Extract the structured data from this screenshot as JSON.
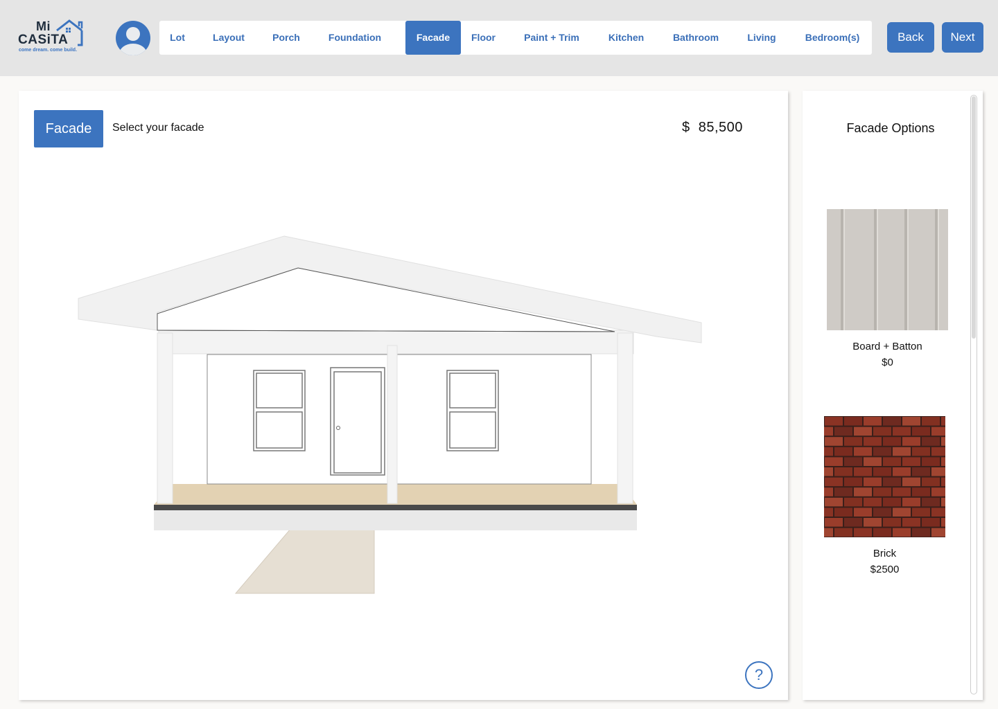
{
  "brand": {
    "line1": "Mi",
    "line2": "CASiTA",
    "tagline": "come dream. come build.",
    "color": "#3c74bf"
  },
  "user": {
    "avatar_icon": "user-avatar-icon"
  },
  "nav": {
    "tabs": [
      {
        "label": "Lot",
        "active": false
      },
      {
        "label": "Layout",
        "active": false
      },
      {
        "label": "Porch",
        "active": false
      },
      {
        "label": "Foundation",
        "active": false
      },
      {
        "label": "Facade",
        "active": true
      },
      {
        "label": "Floor",
        "active": false
      },
      {
        "label": "Paint + Trim",
        "active": false
      },
      {
        "label": "Kitchen",
        "active": false
      },
      {
        "label": "Bathroom",
        "active": false
      },
      {
        "label": "Living",
        "active": false
      },
      {
        "label": "Bedroom(s)",
        "active": false
      }
    ],
    "back_label": "Back",
    "next_label": "Next"
  },
  "main": {
    "step_label": "Facade",
    "step_instruction": "Select your facade",
    "price_display": "$  85,500",
    "help_label": "?"
  },
  "side": {
    "title": "Facade Options",
    "options": [
      {
        "name": "Board + Batton",
        "price": "$0",
        "swatch": "board-batton-swatch",
        "color": "#cfcbc6"
      },
      {
        "name": "Brick",
        "price": "$2500",
        "swatch": "brick-swatch",
        "color": "#8a3324"
      }
    ]
  },
  "colors": {
    "accent": "#3c74bf",
    "header_bg": "#e5e5e5",
    "page_bg": "#faf9f7"
  }
}
